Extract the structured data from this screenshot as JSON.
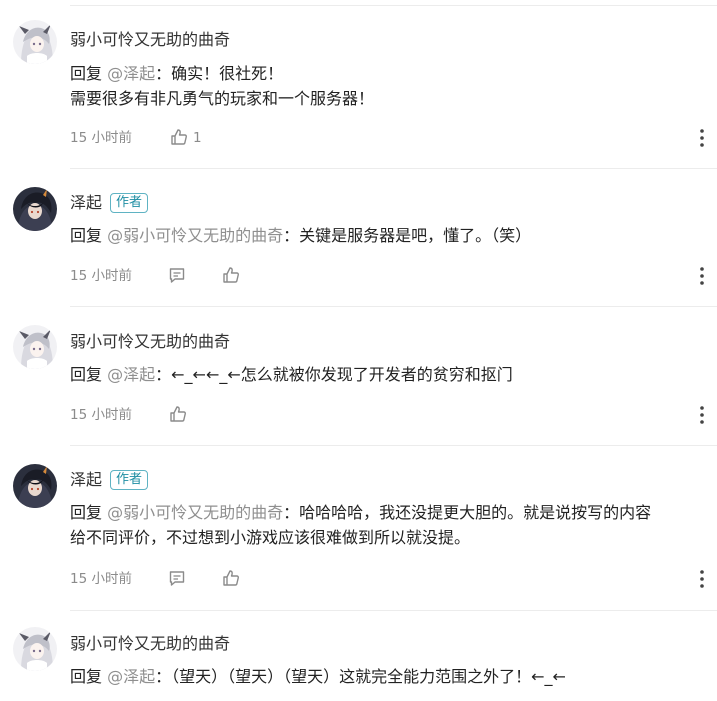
{
  "reply_word": "回复",
  "comments": [
    {
      "author": "弱小可怜又无助的曲奇",
      "is_author": false,
      "mention": "@泽起",
      "separator": "：",
      "lines": [
        "确实！很社死！",
        "需要很多有非凡勇气的玩家和一个服务器！"
      ],
      "time": "15 小时前",
      "likes": "1"
    },
    {
      "author": "泽起",
      "is_author": true,
      "badge": "作者",
      "mention": "@弱小可怜又无助的曲奇",
      "separator": "：",
      "lines": [
        "关键是服务器是吧，懂了。（笑）"
      ],
      "time": "15 小时前"
    },
    {
      "author": "弱小可怜又无助的曲奇",
      "is_author": false,
      "mention": "@泽起",
      "separator": "：",
      "lines": [
        "←_←←_←怎么就被你发现了开发者的贫穷和抠门"
      ],
      "time": "15 小时前"
    },
    {
      "author": "泽起",
      "is_author": true,
      "badge": "作者",
      "mention": "@弱小可怜又无助的曲奇",
      "separator": "：",
      "lines": [
        "哈哈哈哈，我还没提更大胆的。就是说按写的内容",
        "给不同评价，不过想到小游戏应该很难做到所以就没提。"
      ],
      "time": "15 小时前"
    },
    {
      "author": "弱小可怜又无助的曲奇",
      "is_author": false,
      "mention": "@泽起",
      "separator": "：",
      "lines": [
        "（望天）（望天）（望天）这就完全能力范围之外了！←_←"
      ]
    }
  ],
  "icons": {
    "like": "thumbs-up-icon",
    "reply": "reply-bubble-icon",
    "more": "more-vertical-icon",
    "avatar_cookie": "anime-girl-avatar",
    "avatar_zeqi": "dark-character-avatar"
  },
  "colors": {
    "badge": "#1f8ea3",
    "mention": "#8f8f8f",
    "meta": "#8b8b8b",
    "divider": "#ececec"
  }
}
